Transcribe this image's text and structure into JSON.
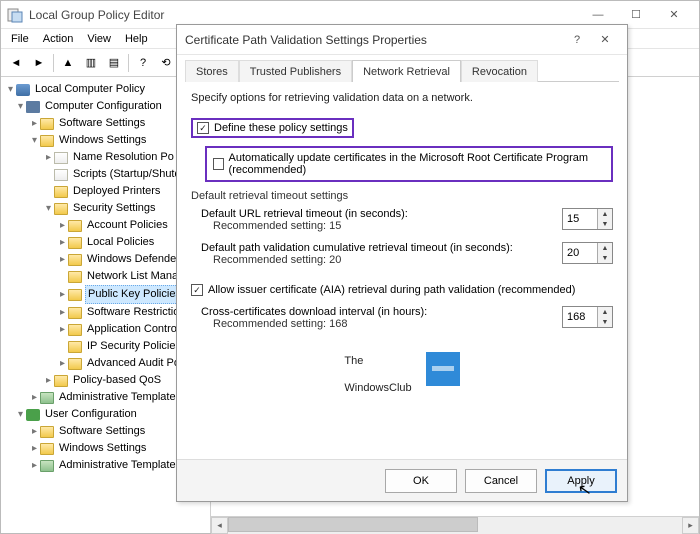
{
  "window": {
    "title": "Local Group Policy Editor",
    "menu": {
      "file": "File",
      "action": "Action",
      "view": "View",
      "help": "Help"
    }
  },
  "tree": {
    "root": "Local Computer Policy",
    "comp": "Computer Configuration",
    "soft": "Software Settings",
    "win": "Windows Settings",
    "nrp": "Name Resolution Po",
    "scripts": "Scripts (Startup/Shutdo",
    "depl": "Deployed Printers",
    "sec": "Security Settings",
    "acct": "Account Policies",
    "local": "Local Policies",
    "wdef": "Windows Defender",
    "netlist": "Network List Manag",
    "pkp": "Public Key Policies",
    "srest": "Software Restriction",
    "appctl": "Application Control",
    "ipsec": "IP Security Policies",
    "audit": "Advanced Audit Po",
    "qos": "Policy-based QoS",
    "adm": "Administrative Templates",
    "user": "User Configuration",
    "usoft": "Software Settings",
    "uwin": "Windows Settings",
    "uadm": "Administrative Templates"
  },
  "dialog": {
    "title": "Certificate Path Validation Settings Properties",
    "tabs": {
      "stores": "Stores",
      "trusted": "Trusted Publishers",
      "network": "Network Retrieval",
      "revocation": "Revocation"
    },
    "intro": "Specify options for retrieving validation data on a network.",
    "define_label": "Define these policy settings",
    "auto_update_label": "Automatically update certificates in the Microsoft Root Certificate Program (recommended)",
    "group_title": "Default retrieval timeout settings",
    "url_timeout_label": "Default URL retrieval timeout (in seconds):",
    "url_timeout_rec": "Recommended setting: 15",
    "url_timeout_value": "15",
    "path_timeout_label": "Default path validation cumulative retrieval timeout (in seconds):",
    "path_timeout_rec": "Recommended setting: 20",
    "path_timeout_value": "20",
    "aia_label": "Allow issuer certificate (AIA) retrieval during path validation (recommended)",
    "cross_label": "Cross-certificates download interval (in hours):",
    "cross_rec": "Recommended setting: 168",
    "cross_value": "168",
    "logo_line1": "The",
    "logo_line2": "WindowsClub",
    "ok": "OK",
    "cancel": "Cancel",
    "apply": "Apply"
  }
}
